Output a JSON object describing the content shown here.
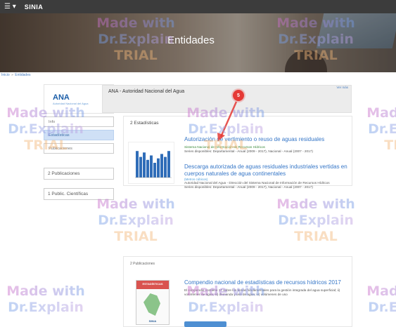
{
  "topbar": {
    "menu_icon": "☰ ▾",
    "brand": "SINIA"
  },
  "hero": {
    "title": "Entidades"
  },
  "breadcrumb": {
    "home": "Inicio",
    "separator": "»",
    "current": "Entidades"
  },
  "sidebar": {
    "logo_text": "ANA",
    "logo_sub": "Autoridad Nacional del Agua",
    "items": [
      "Info",
      "Estadísticas",
      "Publicaciones"
    ],
    "pill_publicaciones": "2 Publicaciones",
    "pill_cientificas": "1 Public. Científicas"
  },
  "org": {
    "name": "ANA - Autoridad Nacional del Agua",
    "link": "Ver más"
  },
  "callout": {
    "number": "5"
  },
  "stats": {
    "label": "2 Estadísticas",
    "bar_values": [
      0.9,
      0.7,
      0.85,
      0.6,
      0.75,
      0.5,
      0.65,
      0.8,
      0.7,
      0.9
    ]
  },
  "results": [
    {
      "title": "Autorización de vertimiento o reuso de aguas residuales",
      "meta_green": "Sistema Nacional de Información de Recursos Hídricos",
      "meta": "Series disponibles: Departamental - Anual (2009 - 2017), Nacional - Anual (2007 - 2017)"
    },
    {
      "title": "Descarga autorizada de aguas residuales industriales vertidas en cuerpos naturales de agua continentales",
      "subtitle": "(Metros cúbicos)",
      "meta": "Autoridad Nacional del Agua - Dirección del Sistema Nacional de Información de Recursos Hídricos",
      "meta2": "Series disponibles: Departamental - Anual (2009 - 2017), Nacional - Anual (2007 - 2017)"
    }
  ],
  "publications": {
    "label": "2 Publicaciones",
    "thumb_header": "ESTADÍSTICAS",
    "thumb_footer": "SINIA",
    "title": "Compendio nacional de estadísticas de recursos hídricos 2017",
    "description": "El compendio contiene 17 sobre los temas fundamentales para la gestión integrada del agua superficial; ii) volúmenes de agua; iii) demanda y uso de agua; iv) volúmenes de uso"
  },
  "watermark": {
    "line1": "Made with",
    "line2": "Dr.Explain",
    "line3": "TRIAL"
  }
}
